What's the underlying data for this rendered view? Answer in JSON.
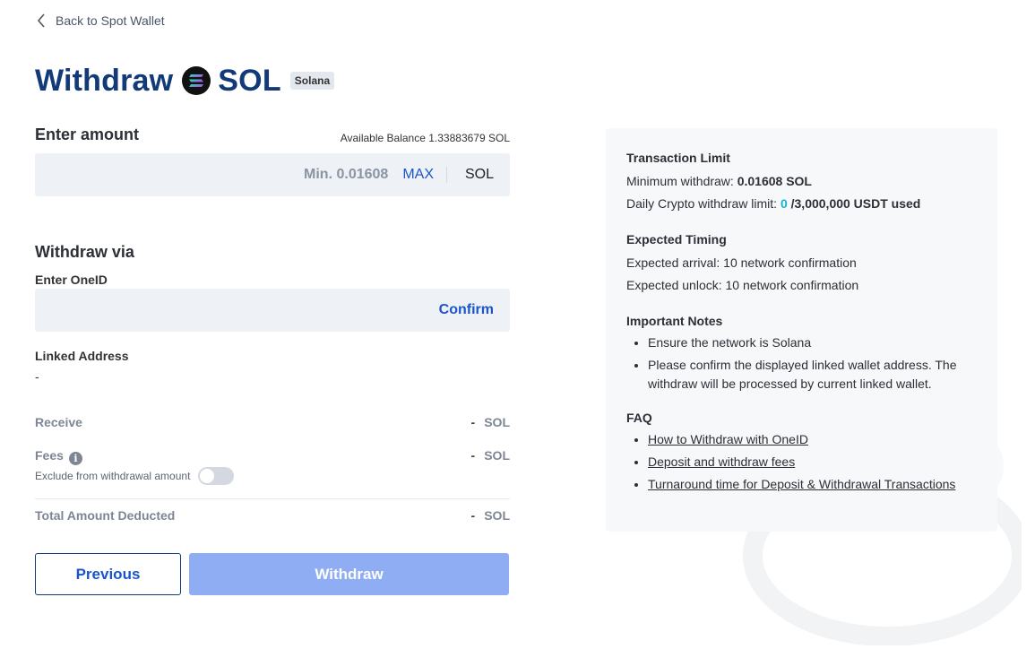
{
  "nav": {
    "back_label": "Back to Spot Wallet"
  },
  "header": {
    "title": "Withdraw",
    "coin": "SOL",
    "chain_tag": "Solana"
  },
  "amount": {
    "title": "Enter amount",
    "available_label": "Available Balance",
    "available_value": "1.33883679 SOL",
    "placeholder": "Min. 0.01608",
    "max_label": "MAX",
    "unit": "SOL"
  },
  "withdraw_via": {
    "title": "Withdraw via",
    "oneid_label": "Enter OneID",
    "confirm_label": "Confirm",
    "linked_label": "Linked Address",
    "linked_value": "-"
  },
  "summary": {
    "receive_label": "Receive",
    "receive_value": "-",
    "receive_unit": "SOL",
    "fees_label": "Fees",
    "fees_info": "i",
    "fees_value": "-",
    "fees_unit": "SOL",
    "exclude_label": "Exclude from withdrawal amount",
    "exclude_on": false,
    "total_label": "Total Amount Deducted",
    "total_value": "-",
    "total_unit": "SOL"
  },
  "buttons": {
    "previous": "Previous",
    "withdraw": "Withdraw"
  },
  "info_panel": {
    "limit_title": "Transaction Limit",
    "min_label": "Minimum withdraw:",
    "min_value": "0.01608 SOL",
    "daily_label": "Daily Crypto withdraw limit:",
    "daily_used": "0",
    "daily_total": "/3,000,000 USDT used",
    "timing_title": "Expected Timing",
    "arrival": "Expected arrival: 10 network confirmation",
    "unlock": "Expected unlock: 10 network confirmation",
    "notes_title": "Important Notes",
    "notes": [
      "Ensure the network is Solana",
      "Please confirm the displayed linked wallet address. The withdraw will be processed by current linked wallet."
    ],
    "faq_title": "FAQ",
    "faq": [
      "How to Withdraw with OneID",
      "Deposit and withdraw fees",
      "Turnaround time for Deposit & Withdrawal Transactions"
    ]
  },
  "colors": {
    "brand": "#123a78",
    "link": "#1a56c9",
    "withdraw_disabled": "#8fadf2",
    "highlight": "#16b2c9"
  },
  "icons": {
    "back": "chevron-left-icon",
    "coin": "solana-logo-icon",
    "info": "info-icon"
  }
}
